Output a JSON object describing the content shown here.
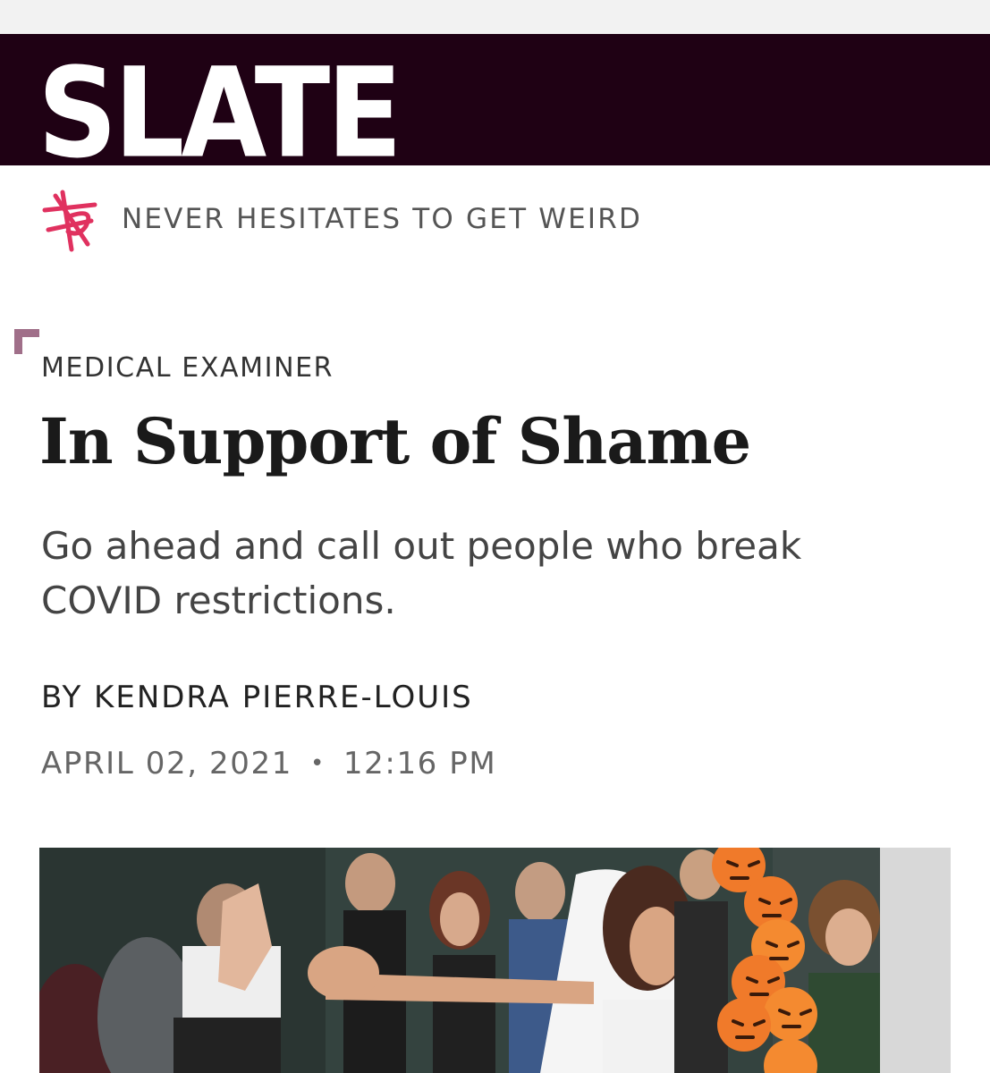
{
  "masthead": {
    "logo_text": "SLATE",
    "background_color": "#1f0114"
  },
  "tagline": {
    "icon": "slate-star-burst-icon",
    "text": "NEVER HESITATES TO GET WEIRD",
    "icon_color": "#e0315f"
  },
  "article": {
    "kicker": "MEDICAL EXAMINER",
    "headline": "In Support of Shame",
    "dek": "Go ahead and call out people who break COVID restrictions.",
    "byline": "BY KENDRA PIERRE-LOUIS",
    "date": "APRIL 02, 2021",
    "separator": "•",
    "time": "12:16 PM"
  },
  "photo": {
    "icon": "angry-reaction-emoji-icon",
    "description_color_accent": "#f07a2a"
  }
}
